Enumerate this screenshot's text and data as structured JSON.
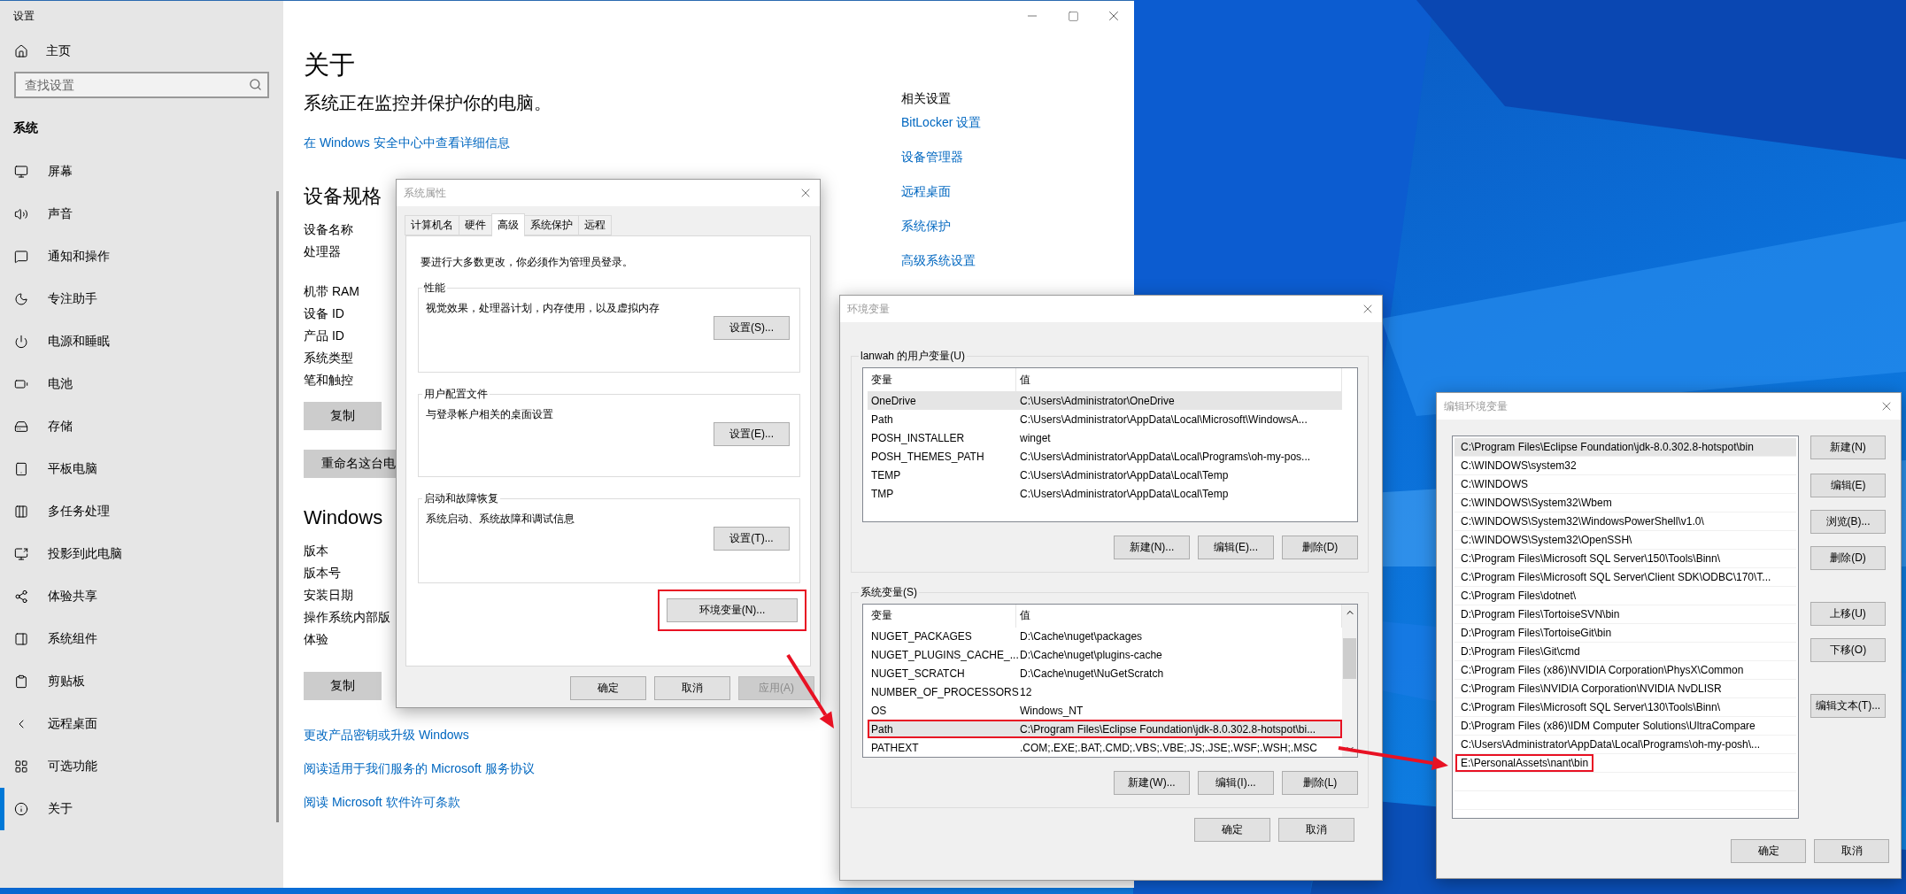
{
  "settings_window": {
    "title": "设置",
    "home": "主页",
    "search": {
      "placeholder": "查找设置"
    },
    "section": "系统",
    "nav_items": [
      {
        "label": "屏幕",
        "selected": false
      },
      {
        "label": "声音",
        "selected": false
      },
      {
        "label": "通知和操作",
        "selected": false
      },
      {
        "label": "专注助手",
        "selected": false
      },
      {
        "label": "电源和睡眠",
        "selected": false
      },
      {
        "label": "电池",
        "selected": false
      },
      {
        "label": "存储",
        "selected": false
      },
      {
        "label": "平板电脑",
        "selected": false
      },
      {
        "label": "多任务处理",
        "selected": false
      },
      {
        "label": "投影到此电脑",
        "selected": false
      },
      {
        "label": "体验共享",
        "selected": false
      },
      {
        "label": "系统组件",
        "selected": false
      },
      {
        "label": "剪贴板",
        "selected": false
      },
      {
        "label": "远程桌面",
        "selected": false
      },
      {
        "label": "可选功能",
        "selected": false
      },
      {
        "label": "关于",
        "selected": true
      }
    ],
    "page": {
      "title": "关于",
      "status": "系统正在监控并保护你的电脑。",
      "security_link": "在 Windows 安全中心中查看详细信息",
      "device_specs": {
        "heading": "设备规格",
        "labels": [
          "设备名称",
          "处理器",
          "机带 RAM",
          "设备 ID",
          "产品 ID",
          "系统类型",
          "笔和触控"
        ],
        "copy_button": "复制",
        "rename_button": "重命名这台电"
      },
      "windows_specs": {
        "heading": "Windows",
        "labels": [
          "版本",
          "版本号",
          "安装日期",
          "操作系统内部版",
          "体验"
        ],
        "copy_button": "复制"
      },
      "links": [
        "更改产品密钥或升级 Windows",
        "阅读适用于我们服务的 Microsoft 服务协议",
        "阅读 Microsoft 软件许可条款"
      ]
    },
    "related": {
      "heading": "相关设置",
      "links": [
        "BitLocker 设置",
        "设备管理器",
        "远程桌面",
        "系统保护",
        "高级系统设置"
      ]
    }
  },
  "system_properties": {
    "title": "系统属性",
    "tabs": [
      {
        "label": "计算机名",
        "selected": false
      },
      {
        "label": "硬件",
        "selected": false
      },
      {
        "label": "高级",
        "selected": true
      },
      {
        "label": "系统保护",
        "selected": false
      },
      {
        "label": "远程",
        "selected": false
      }
    ],
    "notice": "要进行大多数更改，你必须作为管理员登录。",
    "groups": [
      {
        "title": "性能",
        "description": "视觉效果，处理器计划，内存使用，以及虚拟内存",
        "button": "设置(S)..."
      },
      {
        "title": "用户配置文件",
        "description": "与登录帐户相关的桌面设置",
        "button": "设置(E)..."
      },
      {
        "title": "启动和故障恢复",
        "description": "系统启动、系统故障和调试信息",
        "button": "设置(T)..."
      }
    ],
    "env_button": {
      "label": "环境变量(N)...",
      "highlighted": true
    },
    "buttons": [
      {
        "label": "确定",
        "disabled": false
      },
      {
        "label": "取消",
        "disabled": false
      },
      {
        "label": "应用(A)",
        "disabled": true
      }
    ]
  },
  "environment_variables": {
    "title": "环境变量",
    "user_group": {
      "title": "lanwah 的用户变量(U)",
      "columns": [
        "变量",
        "值"
      ],
      "rows": [
        {
          "name": "OneDrive",
          "value": "C:\\Users\\Administrator\\OneDrive",
          "selected": true,
          "highlighted": false
        },
        {
          "name": "Path",
          "value": "C:\\Users\\Administrator\\AppData\\Local\\Microsoft\\WindowsA...",
          "selected": false,
          "highlighted": false
        },
        {
          "name": "POSH_INSTALLER",
          "value": "winget",
          "selected": false,
          "highlighted": false
        },
        {
          "name": "POSH_THEMES_PATH",
          "value": "C:\\Users\\Administrator\\AppData\\Local\\Programs\\oh-my-pos...",
          "selected": false,
          "highlighted": false
        },
        {
          "name": "TEMP",
          "value": "C:\\Users\\Administrator\\AppData\\Local\\Temp",
          "selected": false,
          "highlighted": false
        },
        {
          "name": "TMP",
          "value": "C:\\Users\\Administrator\\AppData\\Local\\Temp",
          "selected": false,
          "highlighted": false
        }
      ],
      "buttons": [
        "新建(N)...",
        "编辑(E)...",
        "删除(D)"
      ]
    },
    "system_group": {
      "title": "系统变量(S)",
      "columns": [
        "变量",
        "值"
      ],
      "rows": [
        {
          "name": "NUGET_PACKAGES",
          "value": "D:\\Cache\\nuget\\packages",
          "selected": false,
          "highlighted": false
        },
        {
          "name": "NUGET_PLUGINS_CACHE_...",
          "value": "D:\\Cache\\nuget\\plugins-cache",
          "selected": false,
          "highlighted": false
        },
        {
          "name": "NUGET_SCRATCH",
          "value": "D:\\Cache\\nuget\\NuGetScratch",
          "selected": false,
          "highlighted": false
        },
        {
          "name": "NUMBER_OF_PROCESSORS",
          "value": "12",
          "selected": false,
          "highlighted": false
        },
        {
          "name": "OS",
          "value": "Windows_NT",
          "selected": false,
          "highlighted": false
        },
        {
          "name": "Path",
          "value": "C:\\Program Files\\Eclipse Foundation\\jdk-8.0.302.8-hotspot\\bi...",
          "selected": true,
          "highlighted": true
        },
        {
          "name": "PATHEXT",
          "value": ".COM;.EXE;.BAT;.CMD;.VBS;.VBE;.JS;.JSE;.WSF;.WSH;.MSC",
          "selected": false,
          "highlighted": false
        }
      ],
      "buttons": [
        "新建(W)...",
        "编辑(I)...",
        "删除(L)"
      ]
    },
    "buttons": [
      "确定",
      "取消"
    ]
  },
  "edit_environment_variable": {
    "title": "编辑环境变量",
    "entries": [
      {
        "value": "C:\\Program Files\\Eclipse Foundation\\jdk-8.0.302.8-hotspot\\bin",
        "selected": true,
        "highlighted": false
      },
      {
        "value": "C:\\WINDOWS\\system32",
        "selected": false,
        "highlighted": false
      },
      {
        "value": "C:\\WINDOWS",
        "selected": false,
        "highlighted": false
      },
      {
        "value": "C:\\WINDOWS\\System32\\Wbem",
        "selected": false,
        "highlighted": false
      },
      {
        "value": "C:\\WINDOWS\\System32\\WindowsPowerShell\\v1.0\\",
        "selected": false,
        "highlighted": false
      },
      {
        "value": "C:\\WINDOWS\\System32\\OpenSSH\\",
        "selected": false,
        "highlighted": false
      },
      {
        "value": "C:\\Program Files\\Microsoft SQL Server\\150\\Tools\\Binn\\",
        "selected": false,
        "highlighted": false
      },
      {
        "value": "C:\\Program Files\\Microsoft SQL Server\\Client SDK\\ODBC\\170\\T...",
        "selected": false,
        "highlighted": false
      },
      {
        "value": "C:\\Program Files\\dotnet\\",
        "selected": false,
        "highlighted": false
      },
      {
        "value": "D:\\Program Files\\TortoiseSVN\\bin",
        "selected": false,
        "highlighted": false
      },
      {
        "value": "D:\\Program Files\\TortoiseGit\\bin",
        "selected": false,
        "highlighted": false
      },
      {
        "value": "D:\\Program Files\\Git\\cmd",
        "selected": false,
        "highlighted": false
      },
      {
        "value": "C:\\Program Files (x86)\\NVIDIA Corporation\\PhysX\\Common",
        "selected": false,
        "highlighted": false
      },
      {
        "value": "C:\\Program Files\\NVIDIA Corporation\\NVIDIA NvDLISR",
        "selected": false,
        "highlighted": false
      },
      {
        "value": "C:\\Program Files\\Microsoft SQL Server\\130\\Tools\\Binn\\",
        "selected": false,
        "highlighted": false
      },
      {
        "value": "D:\\Program Files (x86)\\IDM Computer Solutions\\UltraCompare",
        "selected": false,
        "highlighted": false
      },
      {
        "value": "C:\\Users\\Administrator\\AppData\\Local\\Programs\\oh-my-posh\\...",
        "selected": false,
        "highlighted": false
      },
      {
        "value": "E:\\PersonalAssets\\nant\\bin",
        "selected": false,
        "highlighted": true
      }
    ],
    "buttons": [
      "新建(N)",
      "编辑(E)",
      "浏览(B)...",
      "删除(D)",
      "上移(U)",
      "下移(O)",
      "编辑文本(T)..."
    ],
    "footer_buttons": [
      "确定",
      "取消"
    ]
  }
}
